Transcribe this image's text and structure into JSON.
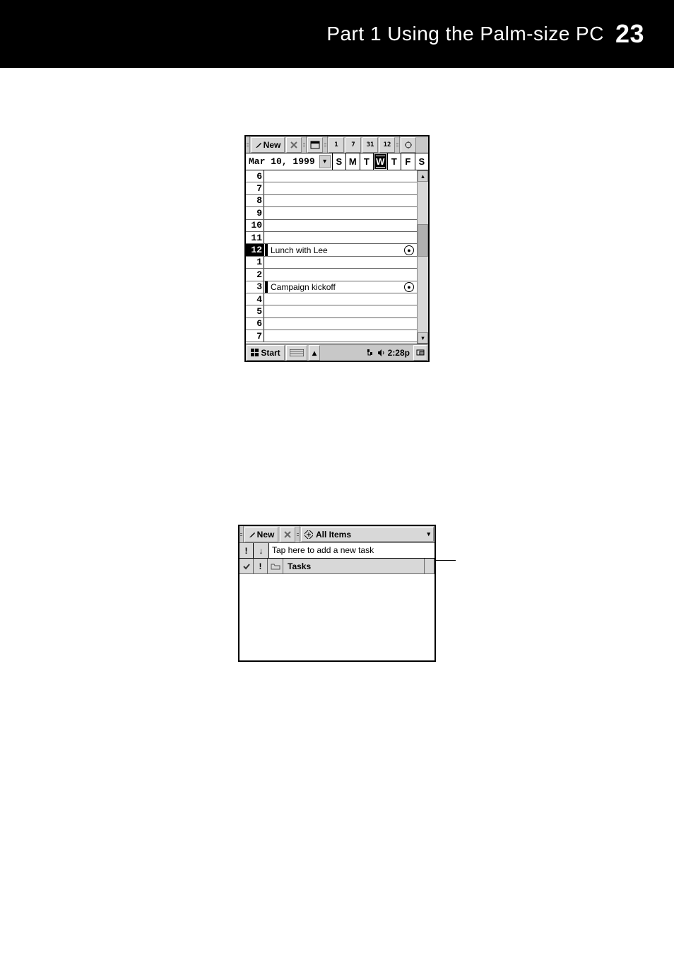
{
  "header": {
    "title": "Part 1  Using the Palm-size PC",
    "page_number": "23"
  },
  "calendar": {
    "toolbar": {
      "new_label": "New"
    },
    "date": "Mar 10, 1999",
    "days_of_week": [
      "S",
      "M",
      "T",
      "W",
      "T",
      "F",
      "S"
    ],
    "selected_day_index": 3,
    "hours": [
      "6",
      "7",
      "8",
      "9",
      "10",
      "11",
      "12",
      "1",
      "2",
      "3",
      "4",
      "5",
      "6",
      "7"
    ],
    "selected_hour_index": 6,
    "events": [
      {
        "hour_index": 6,
        "title": "Lunch with Lee"
      },
      {
        "hour_index": 9,
        "title": "Campaign kickoff"
      }
    ],
    "taskbar": {
      "start_label": "Start",
      "clock": "2:28p"
    }
  },
  "tasks": {
    "toolbar": {
      "new_label": "New",
      "category": "All Items"
    },
    "prompt": "Tap here to add a new task",
    "headers": {
      "tasks": "Tasks"
    }
  }
}
